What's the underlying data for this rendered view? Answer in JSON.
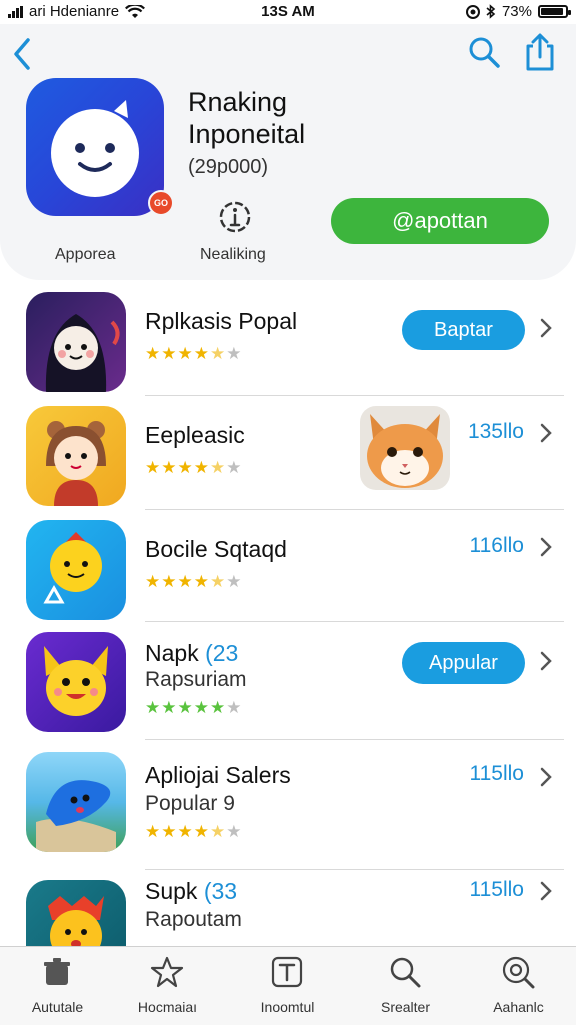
{
  "status_bar": {
    "carrier": "ari Hdenianre",
    "time": "13S AM",
    "battery": "73%"
  },
  "header": {
    "app_title_line1": "Rnaking",
    "app_title_line2": "Inponeital",
    "app_count": "(29p000)",
    "badge_text": "GO",
    "install_label": "@apottan",
    "meta_left_label": "Apporea",
    "meta_mid_label": "Nealiking"
  },
  "list": [
    {
      "title": "Rplkasis Popal",
      "stars": "4.5",
      "button": "Baptar"
    },
    {
      "title": "Eepleasic",
      "stars": "4.5",
      "price": "135llo"
    },
    {
      "title": "Bocile Sqtaqd",
      "stars": "4.5",
      "price": "116llo"
    },
    {
      "title": "Napk",
      "title_accent": "(23",
      "subtitle": "Rapsuriam",
      "stars": "5",
      "button": "Appular"
    },
    {
      "title": "Apliojai Salers",
      "subtitle": "Popular 9",
      "stars": "4.5",
      "price": "115llo"
    },
    {
      "title": "Supk",
      "title_accent": "(33",
      "subtitle": "Rapoutam",
      "price": "115llo"
    }
  ],
  "tabbar": [
    {
      "label": "Aututale",
      "icon": "trash-bin-icon"
    },
    {
      "label": "Hocmaiaı",
      "icon": "star-icon"
    },
    {
      "label": "Inoomtul",
      "icon": "text-box-icon"
    },
    {
      "label": "Srealter",
      "icon": "search-icon"
    },
    {
      "label": "Aahanlc",
      "icon": "search-circle-icon"
    }
  ],
  "colors": {
    "accent": "#1a9de0",
    "install_green": "#3db53d",
    "star": "#f0b400"
  }
}
